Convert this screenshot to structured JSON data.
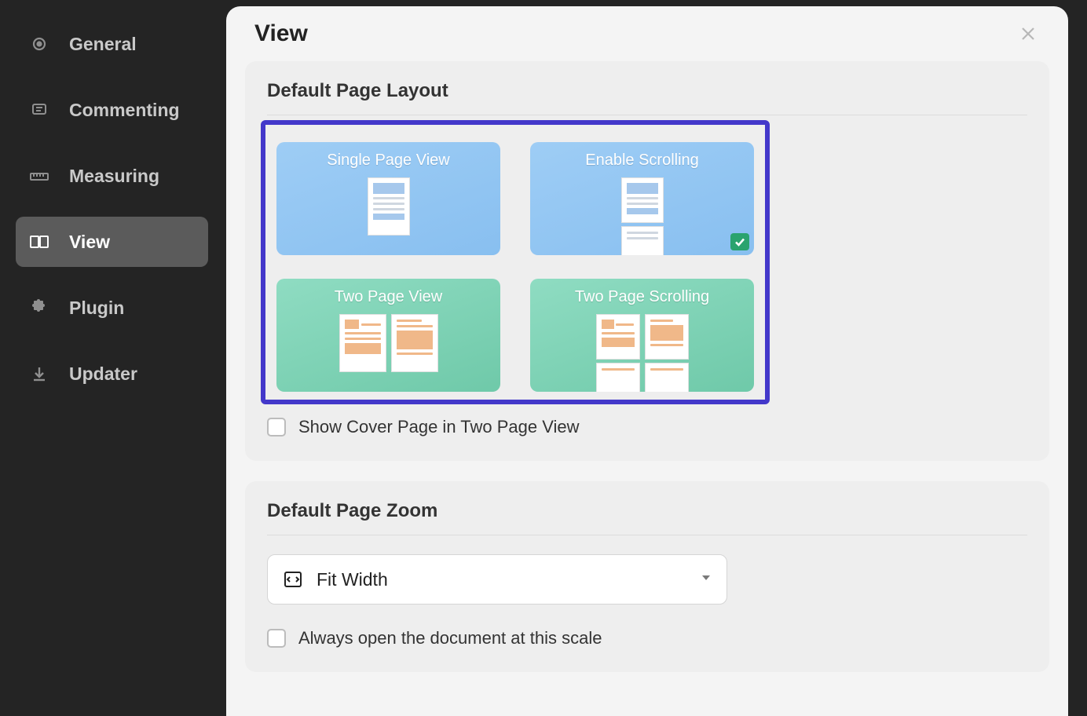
{
  "sidebar": {
    "items": [
      {
        "label": "General"
      },
      {
        "label": "Commenting"
      },
      {
        "label": "Measuring"
      },
      {
        "label": "View"
      },
      {
        "label": "Plugin"
      },
      {
        "label": "Updater"
      }
    ],
    "active_index": 3
  },
  "panel": {
    "title": "View"
  },
  "sections": {
    "layout": {
      "title": "Default Page Layout",
      "tiles": [
        {
          "label": "Single Page View",
          "selected": false
        },
        {
          "label": "Enable Scrolling",
          "selected": true
        },
        {
          "label": "Two Page View",
          "selected": false
        },
        {
          "label": "Two Page Scrolling",
          "selected": false
        }
      ],
      "show_cover_label": "Show Cover Page in Two Page View",
      "show_cover_checked": false
    },
    "zoom": {
      "title": "Default Page Zoom",
      "selected": "Fit Width",
      "always_open_label": "Always open the document at this scale",
      "always_open_checked": false
    }
  }
}
